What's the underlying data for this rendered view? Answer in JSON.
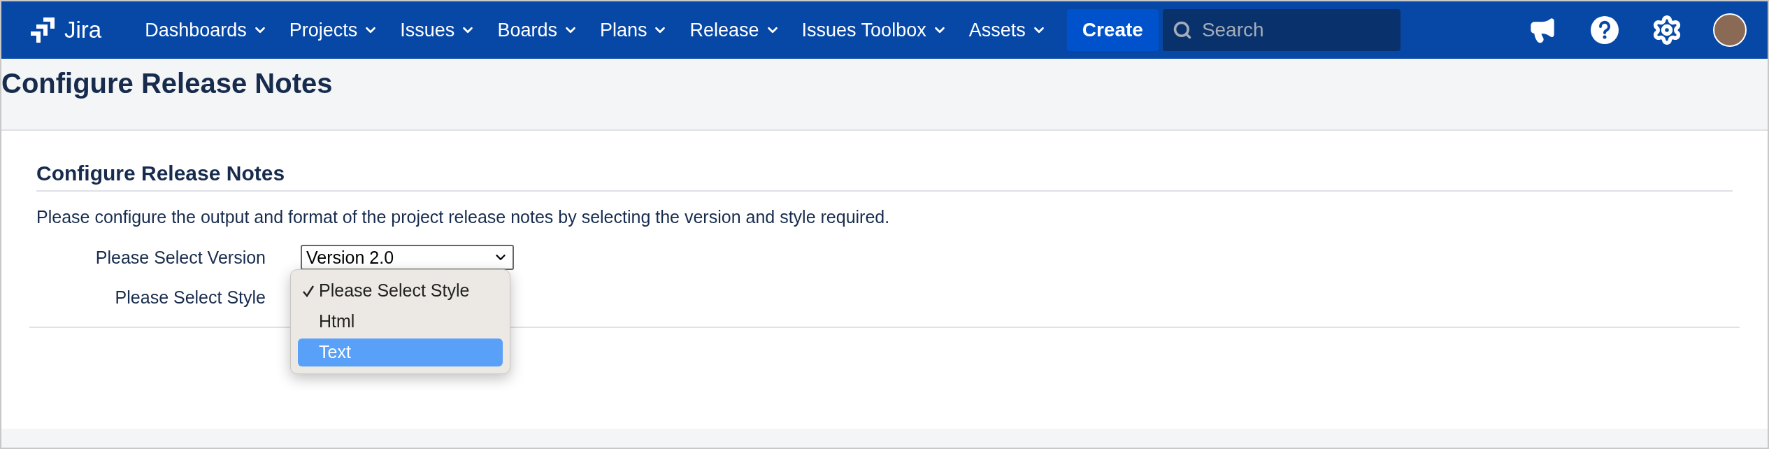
{
  "header": {
    "logo": "Jira",
    "nav": [
      {
        "label": "Dashboards"
      },
      {
        "label": "Projects"
      },
      {
        "label": "Issues"
      },
      {
        "label": "Boards"
      },
      {
        "label": "Plans"
      },
      {
        "label": "Release"
      },
      {
        "label": "Issues Toolbox"
      },
      {
        "label": "Assets"
      }
    ],
    "create": "Create",
    "search": {
      "placeholder": "Search"
    }
  },
  "page_title": "Configure Release Notes",
  "section": {
    "heading": "Configure Release Notes",
    "description": "Please configure the output and format of the project release notes by selecting the version and style required.",
    "fields": [
      {
        "label": "Please Select Version",
        "value": "Version 2.0"
      },
      {
        "label": "Please Select Style"
      }
    ],
    "style_menu": [
      {
        "label": "Please Select Style",
        "selected": true,
        "highlighted": false
      },
      {
        "label": "Html",
        "selected": false,
        "highlighted": false
      },
      {
        "label": "Text",
        "selected": false,
        "highlighted": true
      }
    ]
  }
}
